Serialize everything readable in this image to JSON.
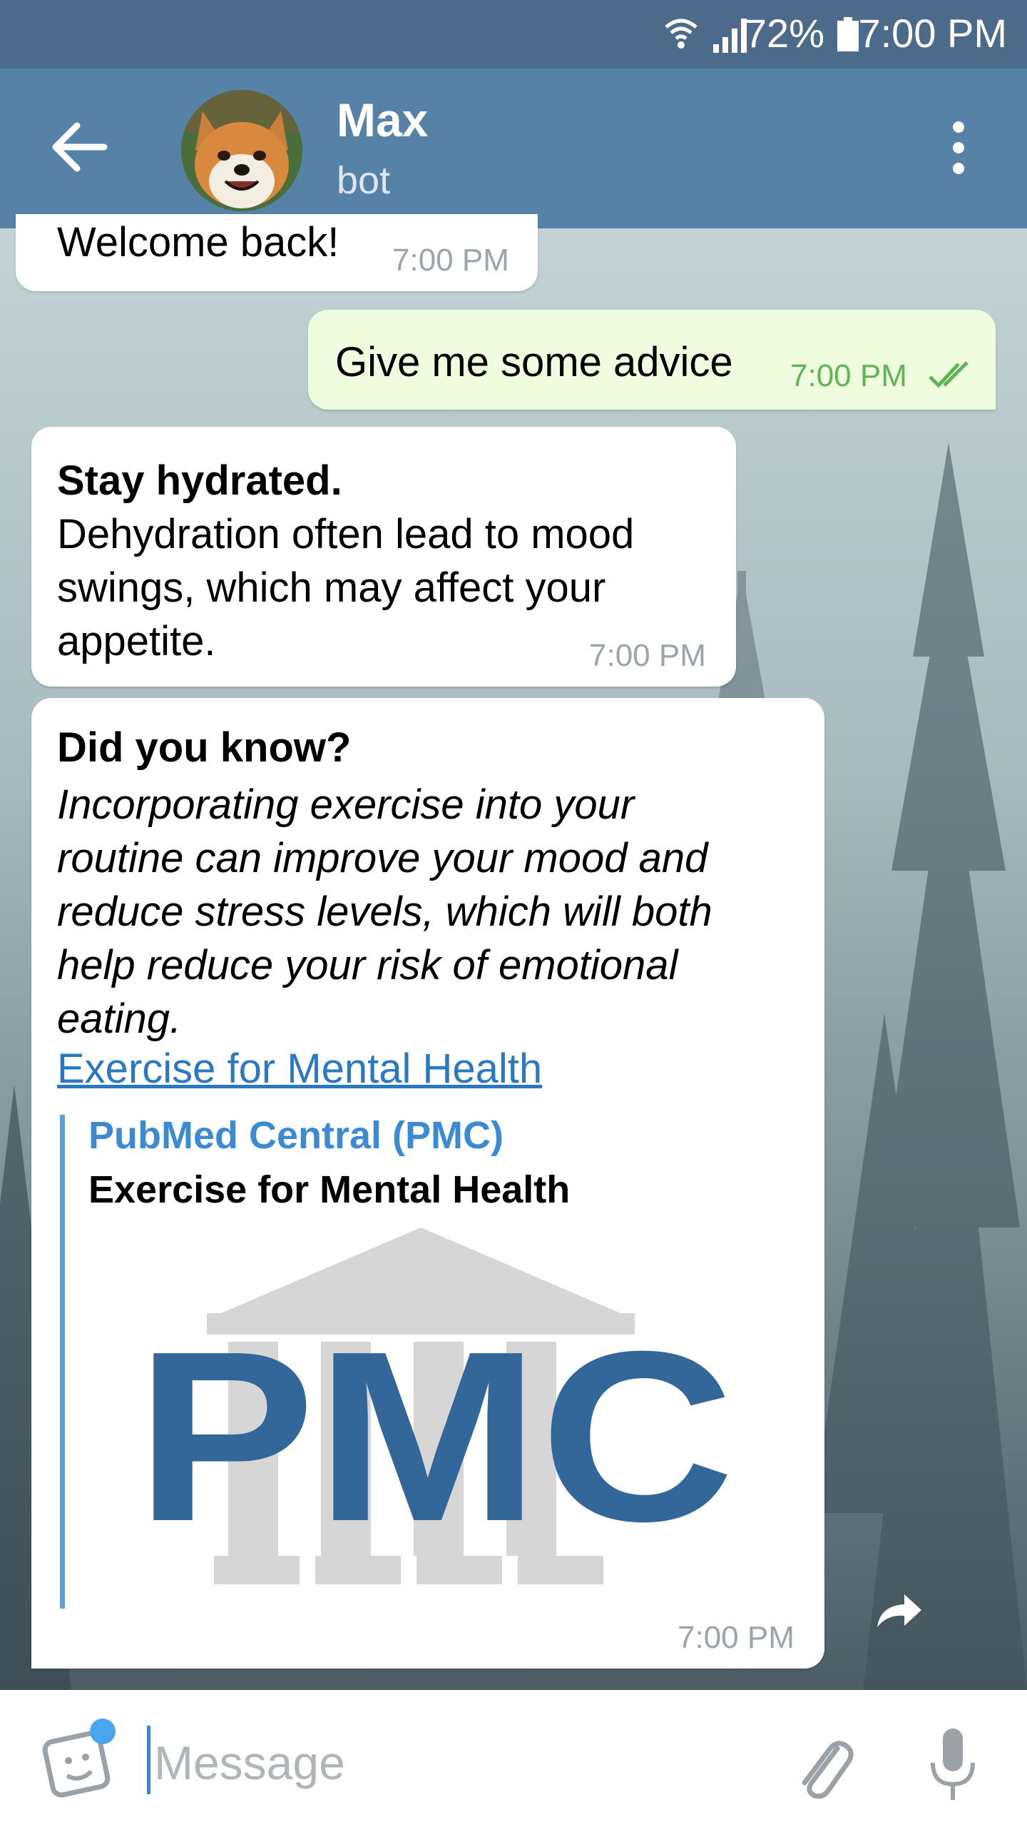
{
  "status_bar": {
    "battery_percent": "72%",
    "time": "7:00 PM",
    "icons": [
      "wifi-icon",
      "signal-icon",
      "battery-icon"
    ]
  },
  "header": {
    "title": "Max",
    "subtitle": "bot",
    "icons": [
      "back-arrow-icon",
      "bot-avatar",
      "more-vert-icon"
    ]
  },
  "messages": [
    {
      "direction": "in",
      "text": "Welcome back!",
      "time": "7:00 PM"
    },
    {
      "direction": "out",
      "text": "Give me some advice",
      "time": "7:00 PM",
      "status_icon": "double-check-icon"
    },
    {
      "direction": "in",
      "title": "Stay hydrated.",
      "text_lines": [
        "Dehydration often lead to mood",
        "swings, which may affect your",
        "appetite."
      ],
      "time": "7:00 PM"
    },
    {
      "direction": "in",
      "title": "Did you know?",
      "text_lines": [
        "Incorporating exercise into your",
        "routine can improve your mood and",
        "reduce stress levels, which will both",
        "help reduce your risk of emotional",
        "eating."
      ],
      "link_text": "Exercise for Mental Health",
      "preview": {
        "site": "PubMed Central (PMC)",
        "title": "Exercise for Mental Health",
        "image_logo_text": "PMC"
      },
      "time": "7:00 PM"
    }
  ],
  "input": {
    "placeholder": "Message",
    "value": "",
    "icons": [
      "sticker-icon",
      "attach-icon",
      "mic-icon",
      "forward-icon"
    ]
  },
  "colors": {
    "header": "#5682a8",
    "status_bar": "#4c6a89",
    "outgoing_bubble": "#effdde",
    "link": "#2a78c2",
    "preview_accent": "#5fa0db",
    "pmc_blue": "#336699"
  }
}
